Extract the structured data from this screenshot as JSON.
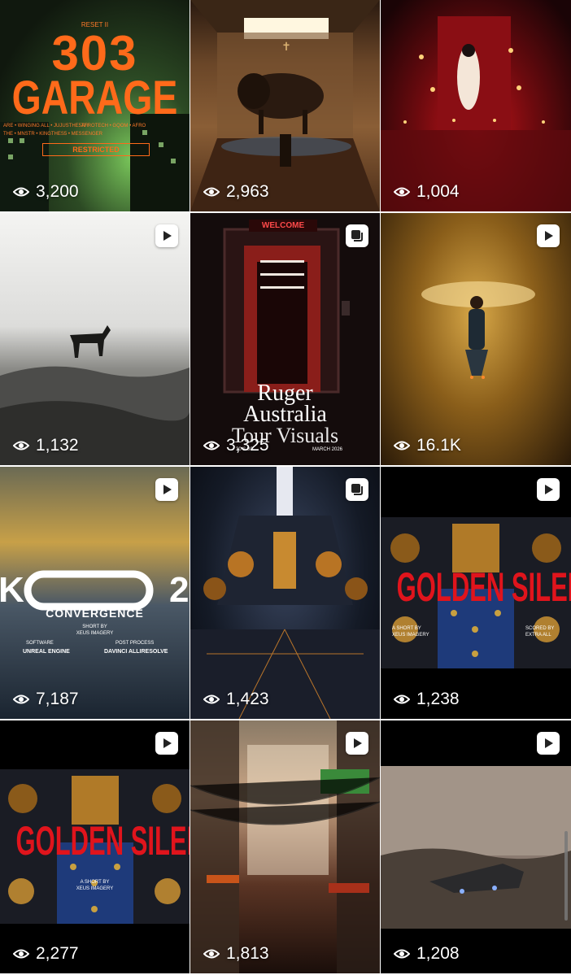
{
  "posts": [
    {
      "views": "3,200",
      "type": "image",
      "overlay": {
        "top": "RESET II",
        "title1": "303",
        "title2": "GARAGE",
        "tag": "RESTRICTED",
        "credits": "AFROTECH • GQOM • AFRO",
        "credits2": "ARE • WINGING ALL • JUJUSTHE5TH",
        "credits3": "THE • MNSTR • KINGTHES5 • MESSENGER"
      },
      "colors": {
        "accent": "#ff6a1a"
      }
    },
    {
      "views": "2,963",
      "type": "image",
      "colors": {
        "accent": "#c98a48"
      }
    },
    {
      "views": "1,004",
      "type": "image",
      "colors": {
        "accent": "#c4141a"
      }
    },
    {
      "views": "1,132",
      "type": "reel",
      "badge_icon": "play-icon",
      "colors": {
        "accent": "#d9d9d9"
      }
    },
    {
      "views": "3,325",
      "type": "carousel",
      "badge_icon": "carousel-icon",
      "overlay": {
        "sign": "WELCOME",
        "line1": "Ruger",
        "line2": "Australia",
        "line3": "Tour Visuals",
        "date": "MARCH 2026",
        "dates_left": "30 & 30"
      },
      "colors": {
        "accent": "#b0221f"
      }
    },
    {
      "views": "16.1K",
      "type": "reel",
      "badge_icon": "play-icon",
      "colors": {
        "accent": "#a0741e"
      }
    },
    {
      "views": "7,187",
      "type": "reel",
      "badge_icon": "play-icon",
      "overlay": {
        "left": "K",
        "right": "2",
        "title": "CONVERGENCE",
        "short_by": "SHORT BY",
        "author": "XEUS IMAGERY",
        "software_label": "SOFTWARE",
        "software": "UNREAL ENGINE",
        "post_label": "POST PROCESS",
        "post": "DAVINCI ALLIRESOLVE"
      },
      "colors": {
        "accent": "#c7a048"
      }
    },
    {
      "views": "1,423",
      "type": "carousel",
      "badge_icon": "carousel-icon",
      "colors": {
        "accent": "#e08a2a"
      }
    },
    {
      "views": "1,238",
      "type": "reel",
      "badge_icon": "play-icon",
      "overlay": {
        "title": "GOLDEN SILENCE",
        "left": "A SHORT BY",
        "left2": "XEUS IMAGERY",
        "right": "SCORED BY",
        "right2": "EXTRA ALL"
      },
      "colors": {
        "accent": "#e0141c"
      }
    },
    {
      "views": "2,277",
      "type": "reel",
      "badge_icon": "play-icon",
      "overlay": {
        "title": "GOLDEN SILENCE",
        "sub": "A SHORT BY",
        "sub2": "XEUS IMAGERY"
      },
      "colors": {
        "accent": "#e0141c"
      }
    },
    {
      "views": "1,813",
      "type": "reel",
      "badge_icon": "play-icon",
      "colors": {
        "accent": "#d8542a"
      }
    },
    {
      "views": "1,208",
      "type": "reel",
      "badge_icon": "play-icon",
      "colors": {
        "accent": "#8a7a70"
      }
    }
  ]
}
